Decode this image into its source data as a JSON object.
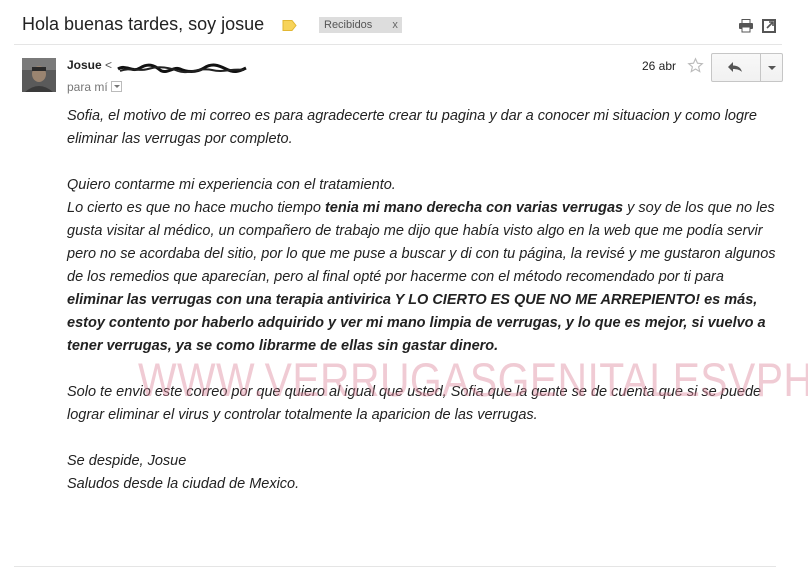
{
  "email": {
    "subject": "Hola buenas tardes, soy josue",
    "label": "Recibidos",
    "label_close": "x",
    "sender_name": "Josue",
    "sender_email_open": "<",
    "recipient": "para mí",
    "date": "26 abr",
    "body": {
      "p1": "Sofia, el motivo de mi correo es para agradecerte crear tu pagina y dar a conocer mi situacion y como logre eliminar las verrugas por completo.",
      "p2_line1": "Quiero contarme mi experiencia con el tratamiento.",
      "p2_a": "Lo cierto es que no hace mucho tiempo ",
      "p2_b": "tenia mi mano derecha con varias verrugas",
      "p2_c": " y soy de los que no les gusta visitar al médico, un compañero de trabajo me dijo que había visto algo en la web que me podía servir pero no se acordaba del sitio, por lo que me puse a buscar y di con tu página, la revisé y me gustaron algunos de los remedios que aparecían, pero al final opté por hacerme con el método recomendado por ti para ",
      "p2_d": "eliminar las verrugas con una terapia antivirica Y LO CIERTO ES QUE NO ME ARREPIENTO! es más, estoy contento por haberlo adquirido y ver mi mano limpia de verrugas, y lo que es mejor, si vuelvo a tener verrugas, ya se como librarme de ellas sin gastar dinero.",
      "p3": "Solo te envio este correo por que quiero al igual que usted, Sofia que la gente se de cuenta que si se puede lograr eliminar el virus y controlar totalmente la aparicion de las verrugas.",
      "p4_line1": "Se despide, Josue",
      "p4_line2": "Saludos desde la ciudad de Mexico."
    }
  },
  "watermark": "WWW.VERRUGASGENITALESVPH.COM",
  "icons": {
    "label_tag": "label-tag-icon",
    "print": "print-icon",
    "popout": "open-in-new-window-icon",
    "star": "star-icon",
    "reply": "reply-icon",
    "more": "chevron-down-icon"
  },
  "colors": {
    "label_tag": "#f7d359",
    "chip_bg": "#dddddd",
    "watermark": "#de8ca0"
  }
}
